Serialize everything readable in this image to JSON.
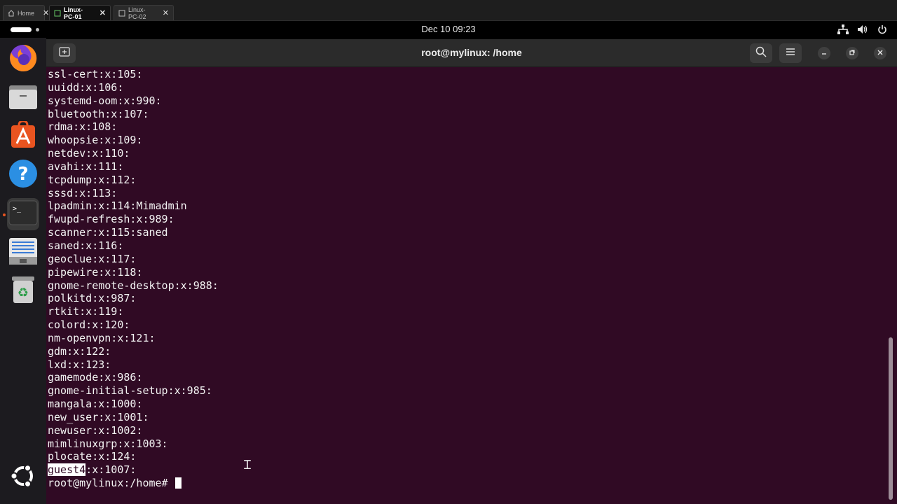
{
  "vm_tabs": [
    {
      "label": "Home",
      "active": false
    },
    {
      "label": "Linux-PC-01",
      "active": true
    },
    {
      "label": "Linux-PC-02",
      "active": false
    }
  ],
  "topbar": {
    "clock": "Dec 10  09:23",
    "tray_icons": [
      "network-icon",
      "volume-icon",
      "power-icon"
    ]
  },
  "dock": {
    "items": [
      "firefox",
      "files",
      "app-center",
      "help",
      "terminal",
      "text-editor",
      "trash",
      "show-apps"
    ],
    "active": "terminal"
  },
  "window": {
    "title": "root@mylinux: /home"
  },
  "terminal": {
    "lines": [
      "ssl-cert:x:105:",
      "uuidd:x:106:",
      "systemd-oom:x:990:",
      "bluetooth:x:107:",
      "rdma:x:108:",
      "whoopsie:x:109:",
      "netdev:x:110:",
      "avahi:x:111:",
      "tcpdump:x:112:",
      "sssd:x:113:",
      "lpadmin:x:114:Mimadmin",
      "fwupd-refresh:x:989:",
      "scanner:x:115:saned",
      "saned:x:116:",
      "geoclue:x:117:",
      "pipewire:x:118:",
      "gnome-remote-desktop:x:988:",
      "polkitd:x:987:",
      "rtkit:x:119:",
      "colord:x:120:",
      "nm-openvpn:x:121:",
      "gdm:x:122:",
      "lxd:x:123:",
      "gamemode:x:986:",
      "gnome-initial-setup:x:985:",
      "mangala:x:1000:",
      "new_user:x:1001:",
      "newuser:x:1002:",
      "mimlinuxgrp:x:1003:",
      "plocate:x:124:"
    ],
    "selected_line": {
      "selected": "guest4",
      "rest": ":x:1007:"
    },
    "prompt": "root@mylinux:/home#"
  },
  "colors": {
    "terminal_bg": "#300a24",
    "terminal_fg": "#f3f3f3",
    "accent": "#e95420"
  }
}
